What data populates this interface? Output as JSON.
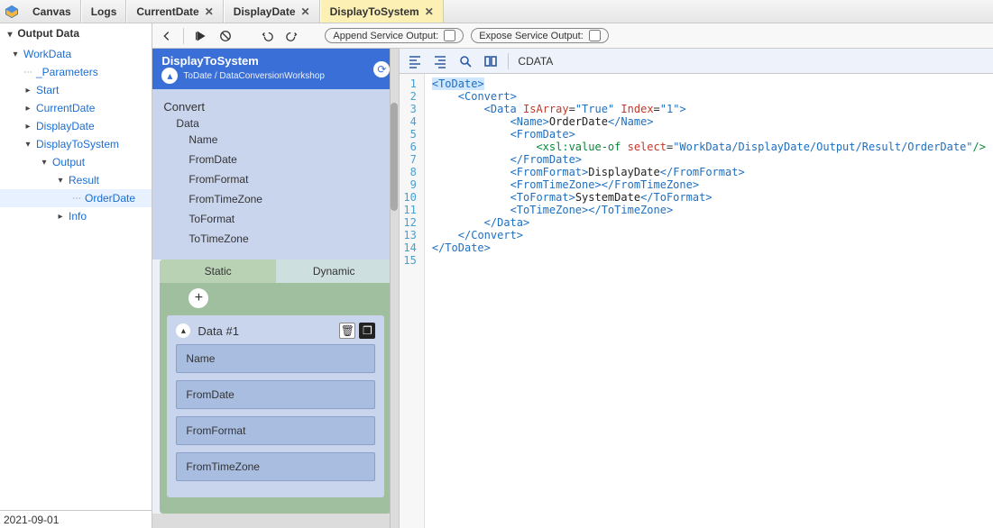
{
  "topbar": {
    "tabs": [
      {
        "label": "Canvas",
        "closable": false,
        "active": false
      },
      {
        "label": "Logs",
        "closable": false,
        "active": false
      },
      {
        "label": "CurrentDate",
        "closable": true,
        "active": false
      },
      {
        "label": "DisplayDate",
        "closable": true,
        "active": false
      },
      {
        "label": "DisplayToSystem",
        "closable": true,
        "active": true
      }
    ]
  },
  "tree": {
    "root": "Output Data",
    "items": [
      {
        "label": "WorkData",
        "lvl": 1,
        "caret": "down",
        "blue": true
      },
      {
        "label": "_Parameters",
        "lvl": 2,
        "caret": "dots",
        "blue": true
      },
      {
        "label": "Start",
        "lvl": 2,
        "caret": "right",
        "blue": true
      },
      {
        "label": "CurrentDate",
        "lvl": 2,
        "caret": "right",
        "blue": true
      },
      {
        "label": "DisplayDate",
        "lvl": 2,
        "caret": "right",
        "blue": true
      },
      {
        "label": "DisplayToSystem",
        "lvl": 2,
        "caret": "down",
        "blue": true
      },
      {
        "label": "Output",
        "lvl": 3,
        "caret": "down",
        "blue": true
      },
      {
        "label": "Result",
        "lvl": 4,
        "caret": "down",
        "blue": true
      },
      {
        "label": "OrderDate",
        "lvl": 5,
        "caret": "dots",
        "blue": true,
        "selected": true
      },
      {
        "label": "Info",
        "lvl": 4,
        "caret": "right",
        "blue": true
      }
    ]
  },
  "statusbar": {
    "text": "2021-09-01"
  },
  "toolbar": {
    "append": {
      "label": "Append Service Output:",
      "checked": false
    },
    "expose": {
      "label": "Expose Service Output:",
      "checked": false
    }
  },
  "center": {
    "title": "DisplayToSystem",
    "sub": "ToDate / DataConversionWorkshop",
    "schema": {
      "root": "Convert",
      "l1": "Data",
      "l2": [
        "Name",
        "FromDate",
        "FromFormat",
        "FromTimeZone",
        "ToFormat",
        "ToTimeZone"
      ]
    },
    "cfg_tabs": {
      "static": "Static",
      "dynamic": "Dynamic"
    },
    "item_title": "Data #1",
    "fields": [
      "Name",
      "FromDate",
      "FromFormat",
      "FromTimeZone"
    ]
  },
  "code_tb": {
    "mode_label": "CDATA"
  },
  "code_lines": 15,
  "chart_data": {
    "type": "table",
    "note": "XML content shown in code editor",
    "xml": [
      {
        "n": 1,
        "indent": 0,
        "kind": "open",
        "tag": "ToDate",
        "hl": true
      },
      {
        "n": 2,
        "indent": 1,
        "kind": "open",
        "tag": "Convert"
      },
      {
        "n": 3,
        "indent": 2,
        "kind": "open",
        "tag": "Data",
        "attrs": [
          [
            "IsArray",
            "True"
          ],
          [
            "Index",
            "1"
          ]
        ]
      },
      {
        "n": 4,
        "indent": 3,
        "kind": "elem",
        "tag": "Name",
        "text": "OrderDate"
      },
      {
        "n": 5,
        "indent": 3,
        "kind": "open",
        "tag": "FromDate"
      },
      {
        "n": 6,
        "indent": 4,
        "kind": "xslvalueof",
        "select": "WorkData/DisplayDate/Output/Result/OrderDate"
      },
      {
        "n": 7,
        "indent": 3,
        "kind": "close",
        "tag": "FromDate"
      },
      {
        "n": 8,
        "indent": 3,
        "kind": "elem",
        "tag": "FromFormat",
        "text": "DisplayDate"
      },
      {
        "n": 9,
        "indent": 3,
        "kind": "empty",
        "tag": "FromTimeZone"
      },
      {
        "n": 10,
        "indent": 3,
        "kind": "elem",
        "tag": "ToFormat",
        "text": "SystemDate"
      },
      {
        "n": 11,
        "indent": 3,
        "kind": "empty",
        "tag": "ToTimeZone"
      },
      {
        "n": 12,
        "indent": 2,
        "kind": "close",
        "tag": "Data"
      },
      {
        "n": 13,
        "indent": 1,
        "kind": "close",
        "tag": "Convert"
      },
      {
        "n": 14,
        "indent": 0,
        "kind": "close",
        "tag": "ToDate"
      },
      {
        "n": 15,
        "indent": 0,
        "kind": "blank"
      }
    ]
  }
}
